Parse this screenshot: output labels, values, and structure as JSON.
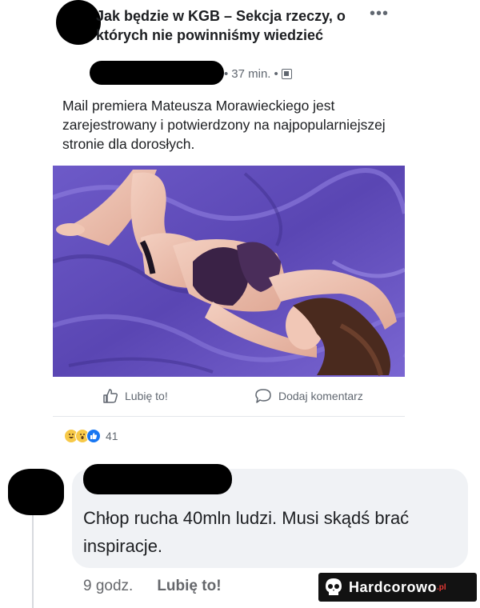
{
  "post": {
    "group_title": "Jak będzie w KGB – Sekcja rzeczy, o których nie powinniśmy wiedzieć",
    "time": "37 min.",
    "text": "Mail premiera Mateusza Morawieckiego jest zarejestrowany i potwierdzony na najpopularniejszej stronie dla dorosłych.",
    "photo_icon": "photo-of-woman-on-purple-sheets",
    "actions": {
      "like": "Lubię to!",
      "comment": "Dodaj komentarz"
    },
    "reactions": {
      "icons": [
        "laugh-reaction-icon",
        "wow-reaction-icon",
        "like-reaction-icon"
      ],
      "count": "41"
    }
  },
  "comment": {
    "text": "Chłop rucha 40mln ludzi. Musi skądś brać inspiracje.",
    "time": "9 godz.",
    "like": "Lubię to!"
  },
  "watermark": {
    "brand": "Hardcorowo",
    "suffix": ".pl"
  },
  "colors": {
    "bubble": "#f0f2f5",
    "meta_gray": "#606770",
    "sheet_purple": "#6a55c2",
    "watermark_bg": "#121212"
  }
}
